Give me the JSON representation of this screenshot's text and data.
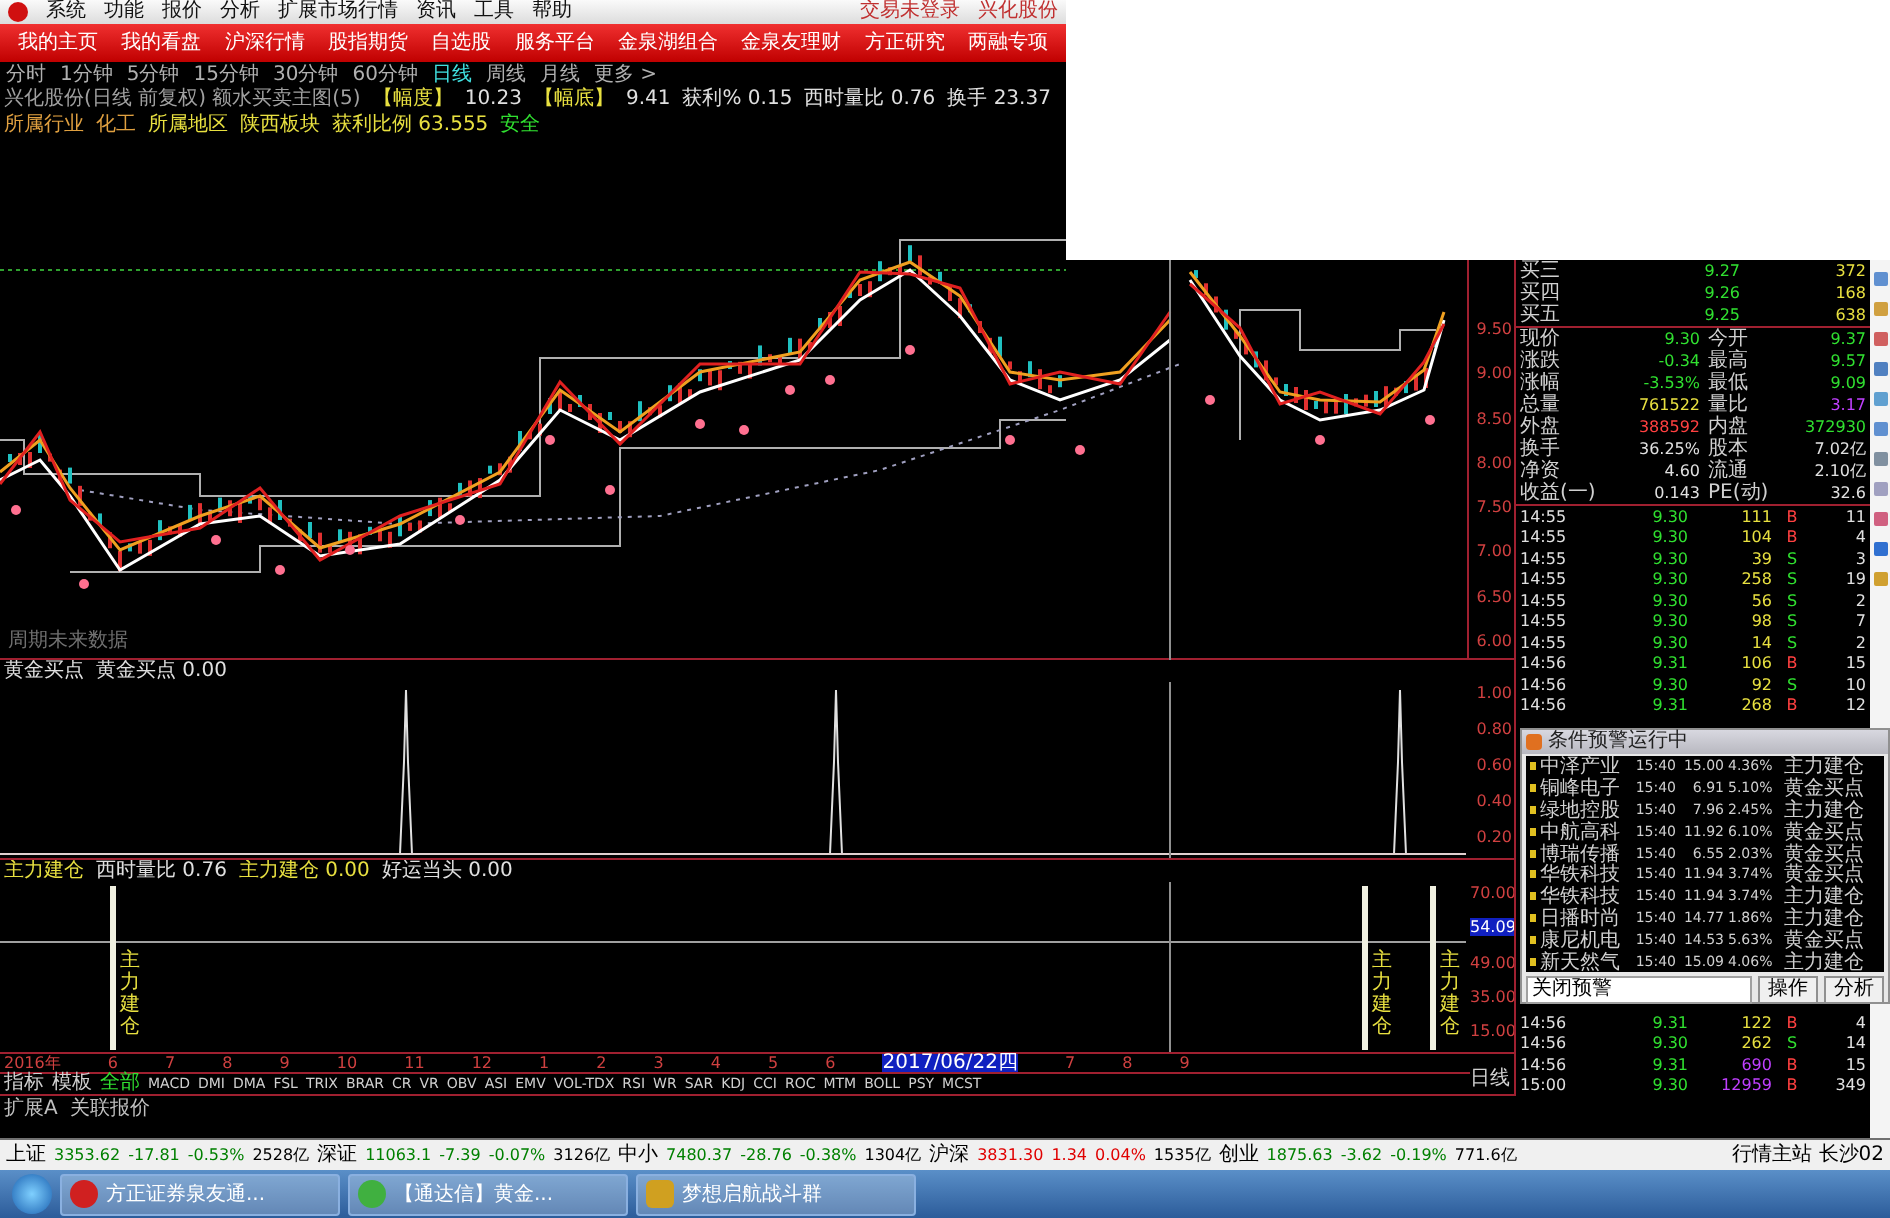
{
  "menu_bar": {
    "items": [
      "系统",
      "功能",
      "报价",
      "分析",
      "扩展市场行情",
      "资讯",
      "工具",
      "帮助"
    ],
    "right": [
      "交易未登录",
      "兴化股份"
    ]
  },
  "nav_tabs": [
    "我的主页",
    "我的看盘",
    "沪深行情",
    "股指期货",
    "自选股",
    "服务平台",
    "金泉湖组合",
    "金泉友理财",
    "方正研究",
    "两融专项"
  ],
  "periods": [
    {
      "label": "分时",
      "selected": false
    },
    {
      "label": "1分钟",
      "selected": false
    },
    {
      "label": "5分钟",
      "selected": false
    },
    {
      "label": "15分钟",
      "selected": false
    },
    {
      "label": "30分钟",
      "selected": false
    },
    {
      "label": "60分钟",
      "selected": false
    },
    {
      "label": "日线",
      "selected": true
    },
    {
      "label": "周线",
      "selected": false
    },
    {
      "label": "月线",
      "selected": false
    },
    {
      "label": "更多 >",
      "selected": false
    }
  ],
  "info_lines": [
    [
      {
        "text": "兴化股份(日线 前复权) 额水买卖主图(5)",
        "color": "#a0a0a0"
      },
      {
        "text": "【幅度】",
        "color": "#e8e040"
      },
      {
        "text": "10.23",
        "color": "#e0e0e0"
      },
      {
        "text": "【幅底】",
        "color": "#e8e040"
      },
      {
        "text": "9.41",
        "color": "#e0e0e0"
      },
      {
        "text": "获利% 0.15",
        "color": "#e0e0e0"
      },
      {
        "text": "西时量比 0.76",
        "color": "#e0e0e0"
      },
      {
        "text": "换手 23.37",
        "color": "#e0e0e0"
      }
    ],
    [
      {
        "text": "所属行业",
        "color": "#e0a040"
      },
      {
        "text": "化工",
        "color": "#e0a040"
      },
      {
        "text": "所属地区",
        "color": "#e8e040"
      },
      {
        "text": "陕西板块",
        "color": "#e8e040"
      },
      {
        "text": "获利比例 63.555",
        "color": "#e8e040"
      },
      {
        "text": "安全",
        "color": "#30e030"
      }
    ]
  ],
  "main_chart": {
    "note": "周期未来数据",
    "axis": [
      "9.50",
      "9.00",
      "8.50",
      "8.00",
      "7.50",
      "7.00",
      "6.50",
      "6.00"
    ]
  },
  "sub_chart_1": {
    "legend": [
      {
        "text": "黄金买点",
        "color": "#e0e0e0"
      },
      {
        "text": "黄金买点 0.00",
        "color": "#e0e0e0"
      }
    ],
    "axis": [
      "1.00",
      "0.80",
      "0.60",
      "0.40",
      "0.20"
    ]
  },
  "sub_chart_2": {
    "legend": [
      {
        "text": "主力建仓",
        "color": "#e8e040"
      },
      {
        "text": "西时量比 0.76",
        "color": "#e0e0e0"
      },
      {
        "text": "主力建仓 0.00",
        "color": "#e8e040"
      },
      {
        "text": "好运当头 0.00",
        "color": "#e0e0e0"
      }
    ],
    "signals": [
      "主力建仓",
      "主力建仓",
      "主力建仓"
    ],
    "axis": [
      {
        "label": "70.00",
        "kind": "tick"
      },
      {
        "label": "54.09",
        "kind": "cursor"
      },
      {
        "label": "49.00",
        "kind": "tick"
      },
      {
        "label": "35.00",
        "kind": "tick"
      },
      {
        "label": "15.00",
        "kind": "tick"
      }
    ]
  },
  "date_axis": {
    "dates": [
      {
        "label": "2016年",
        "selected": false
      },
      {
        "label": "6",
        "selected": false
      },
      {
        "label": "7",
        "selected": false
      },
      {
        "label": "8",
        "selected": false
      },
      {
        "label": "9",
        "selected": false
      },
      {
        "label": "10",
        "selected": false
      },
      {
        "label": "11",
        "selected": false
      },
      {
        "label": "12",
        "selected": false
      },
      {
        "label": "1",
        "selected": false
      },
      {
        "label": "2",
        "selected": false
      },
      {
        "label": "3",
        "selected": false
      },
      {
        "label": "4",
        "selected": false
      },
      {
        "label": "5",
        "selected": false
      },
      {
        "label": "6",
        "selected": false
      },
      {
        "label": "2017/06/22四",
        "selected": true
      },
      {
        "label": "7",
        "selected": false
      },
      {
        "label": "8",
        "selected": false
      },
      {
        "label": "9",
        "selected": false
      }
    ],
    "period": "日线"
  },
  "indicator_tabs": [
    {
      "label": "指标",
      "selected": false
    },
    {
      "label": "模板",
      "selected": false
    },
    {
      "label": "全部",
      "selected": true
    },
    {
      "label": "MACD",
      "selected": false
    },
    {
      "label": "DMI",
      "selected": false
    },
    {
      "label": "DMA",
      "selected": false
    },
    {
      "label": "FSL",
      "selected": false
    },
    {
      "label": "TRIX",
      "selected": false
    },
    {
      "label": "BRAR",
      "selected": false
    },
    {
      "label": "CR",
      "selected": false
    },
    {
      "label": "VR",
      "selected": false
    },
    {
      "label": "OBV",
      "selected": false
    },
    {
      "label": "ASI",
      "selected": false
    },
    {
      "label": "EMV",
      "selected": false
    },
    {
      "label": "VOL-TDX",
      "selected": false
    },
    {
      "label": "RSI",
      "selected": false
    },
    {
      "label": "WR",
      "selected": false
    },
    {
      "label": "SAR",
      "selected": false
    },
    {
      "label": "KDJ",
      "selected": false
    },
    {
      "label": "CCI",
      "selected": false
    },
    {
      "label": "ROC",
      "selected": false
    },
    {
      "label": "MTM",
      "selected": false
    },
    {
      "label": "BOLL",
      "selected": false
    },
    {
      "label": "PSY",
      "selected": false
    },
    {
      "label": "MCST",
      "selected": false
    }
  ],
  "extension_tabs": [
    "扩展A",
    "关联报价"
  ],
  "quote": {
    "bids": [
      {
        "label": "买三",
        "price": "9.27",
        "volume": "372"
      },
      {
        "label": "买四",
        "price": "9.26",
        "volume": "168"
      },
      {
        "label": "买五",
        "price": "9.25",
        "volume": "638"
      }
    ],
    "stats": [
      {
        "label": "现价",
        "value": "9.30",
        "color": "#30e030"
      },
      {
        "label": "今开",
        "value": "9.37",
        "color": "#30e030"
      },
      {
        "label": "涨跌",
        "value": "-0.34",
        "color": "#30e030"
      },
      {
        "label": "最高",
        "value": "9.57",
        "color": "#30e030"
      },
      {
        "label": "涨幅",
        "value": "-3.53%",
        "color": "#30e030"
      },
      {
        "label": "最低",
        "value": "9.09",
        "color": "#30e030"
      },
      {
        "label": "总量",
        "value": "761522",
        "color": "#e8e040"
      },
      {
        "label": "量比",
        "value": "3.17",
        "color": "#c040ff"
      },
      {
        "label": "外盘",
        "value": "388592",
        "color": "#ff4040"
      },
      {
        "label": "内盘",
        "value": "372930",
        "color": "#30e030"
      },
      {
        "label": "换手",
        "value": "36.25%",
        "color": "#e0e0e0"
      },
      {
        "label": "股本",
        "value": "7.02亿",
        "color": "#e0e0e0"
      },
      {
        "label": "净资",
        "value": "4.60",
        "color": "#e0e0e0"
      },
      {
        "label": "流通",
        "value": "2.10亿",
        "color": "#e0e0e0"
      },
      {
        "label": "收益(一)",
        "value": "0.143",
        "color": "#e0e0e0"
      },
      {
        "label": "PE(动)",
        "value": "32.6",
        "color": "#e0e0e0"
      }
    ],
    "ticks": [
      {
        "time": "14:55",
        "price": "9.30",
        "volume": "111",
        "side": "B",
        "count": "11",
        "big": false
      },
      {
        "time": "14:55",
        "price": "9.30",
        "volume": "104",
        "side": "B",
        "count": "4",
        "big": false
      },
      {
        "time": "14:55",
        "price": "9.30",
        "volume": "39",
        "side": "S",
        "count": "3",
        "big": false
      },
      {
        "time": "14:55",
        "price": "9.30",
        "volume": "258",
        "side": "S",
        "count": "19",
        "big": false
      },
      {
        "time": "14:55",
        "price": "9.30",
        "volume": "56",
        "side": "S",
        "count": "2",
        "big": false
      },
      {
        "time": "14:55",
        "price": "9.30",
        "volume": "98",
        "side": "S",
        "count": "7",
        "big": false
      },
      {
        "time": "14:55",
        "price": "9.30",
        "volume": "14",
        "side": "S",
        "count": "2",
        "big": false
      },
      {
        "time": "14:56",
        "price": "9.31",
        "volume": "106",
        "side": "B",
        "count": "15",
        "big": false
      },
      {
        "time": "14:56",
        "price": "9.30",
        "volume": "92",
        "side": "S",
        "count": "10",
        "big": false
      },
      {
        "time": "14:56",
        "price": "9.31",
        "volume": "268",
        "side": "B",
        "count": "12",
        "big": false
      }
    ],
    "late_ticks": [
      {
        "time": "14:56",
        "price": "9.31",
        "volume": "122",
        "side": "B",
        "count": "4",
        "big": false
      },
      {
        "time": "14:56",
        "price": "9.30",
        "volume": "262",
        "side": "S",
        "count": "14",
        "big": false
      },
      {
        "time": "14:56",
        "price": "9.31",
        "volume": "690",
        "side": "B",
        "count": "15",
        "big": true
      },
      {
        "time": "15:00",
        "price": "9.30",
        "volume": "12959",
        "side": "B",
        "count": "349",
        "big": true
      }
    ]
  },
  "alert_window": {
    "title": "条件预警运行中",
    "rows": [
      {
        "name": "中泽产业",
        "time": "15:40",
        "price": "15.00",
        "pct": "4.36%",
        "signal": "主力建仓"
      },
      {
        "name": "铜峰电子",
        "time": "15:40",
        "price": "6.91",
        "pct": "5.10%",
        "signal": "黄金买点"
      },
      {
        "name": "绿地控股",
        "time": "15:40",
        "price": "7.96",
        "pct": "2.45%",
        "signal": "主力建仓"
      },
      {
        "name": "中航高科",
        "time": "15:40",
        "price": "11.92",
        "pct": "6.10%",
        "signal": "黄金买点"
      },
      {
        "name": "博瑞传播",
        "time": "15:40",
        "price": "6.55",
        "pct": "2.03%",
        "signal": "黄金买点"
      },
      {
        "name": "华铁科技",
        "time": "15:40",
        "price": "11.94",
        "pct": "3.74%",
        "signal": "黄金买点"
      },
      {
        "name": "华铁科技",
        "time": "15:40",
        "price": "11.94",
        "pct": "3.74%",
        "signal": "主力建仓"
      },
      {
        "name": "日播时尚",
        "time": "15:40",
        "price": "14.77",
        "pct": "1.86%",
        "signal": "主力建仓"
      },
      {
        "name": "康尼机电",
        "time": "15:40",
        "price": "14.53",
        "pct": "5.63%",
        "signal": "黄金买点"
      },
      {
        "name": "新天然气",
        "time": "15:40",
        "price": "15.09",
        "pct": "4.06%",
        "signal": "主力建仓"
      }
    ],
    "field": "关闭预警",
    "buttons": [
      "操作",
      "分析"
    ]
  },
  "status_bar": {
    "indices": [
      {
        "name": "上证",
        "value": "3353.62",
        "change": "-17.81",
        "pct": "-0.53%",
        "amount": "2528亿",
        "color": "#008000"
      },
      {
        "name": "深证",
        "value": "11063.1",
        "change": "-7.39",
        "pct": "-0.07%",
        "amount": "3126亿",
        "color": "#008000"
      },
      {
        "name": "中小",
        "value": "7480.37",
        "change": "-28.76",
        "pct": "-0.38%",
        "amount": "1304亿",
        "color": "#008000"
      },
      {
        "name": "沪深",
        "value": "3831.30",
        "change": "1.34",
        "pct": "0.04%",
        "amount": "1535亿",
        "color": "#e00000"
      },
      {
        "name": "创业",
        "value": "1875.63",
        "change": "-3.62",
        "pct": "-0.19%",
        "amount": "771.6亿",
        "color": "#008000"
      }
    ],
    "server": "行情主站 长沙02"
  },
  "taskbar": {
    "tasks": [
      {
        "title": "方正证券泉友通...",
        "kind": "swirl"
      },
      {
        "title": "【通达信】黄金...",
        "kind": "refresh"
      },
      {
        "title": "梦想启航战斗群",
        "kind": "game"
      }
    ]
  }
}
